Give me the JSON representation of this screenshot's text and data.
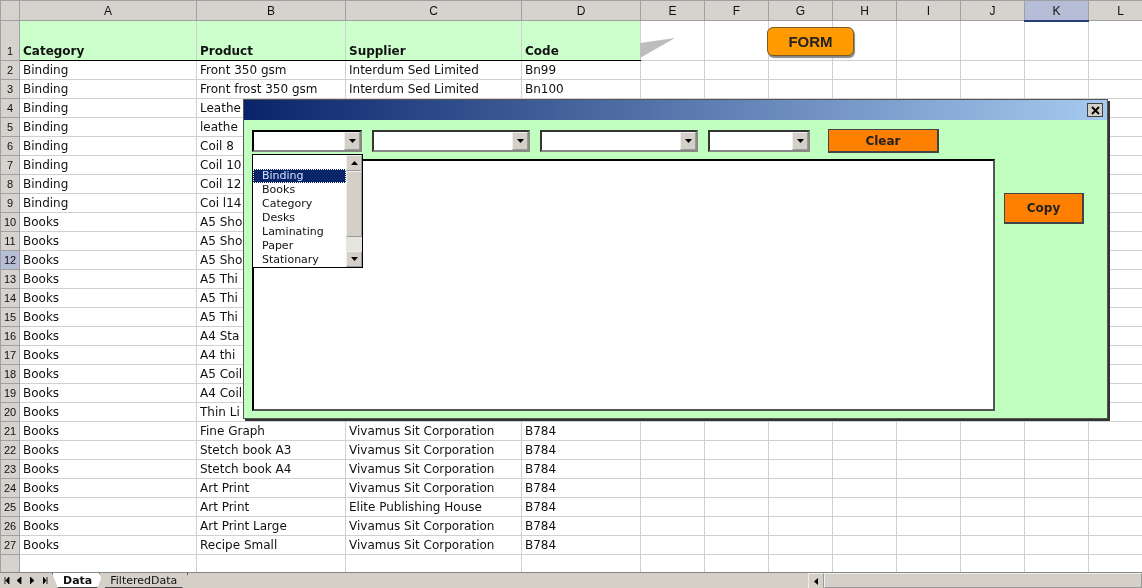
{
  "columns": [
    {
      "label": "A",
      "selected": false
    },
    {
      "label": "B",
      "selected": false
    },
    {
      "label": "C",
      "selected": false
    },
    {
      "label": "D",
      "selected": false
    },
    {
      "label": "E",
      "selected": false
    },
    {
      "label": "F",
      "selected": false
    },
    {
      "label": "G",
      "selected": false
    },
    {
      "label": "H",
      "selected": false
    },
    {
      "label": "I",
      "selected": false
    },
    {
      "label": "J",
      "selected": false
    },
    {
      "label": "K",
      "selected": true
    },
    {
      "label": "L",
      "selected": false
    }
  ],
  "rows": [
    {
      "number": "1",
      "selected": false,
      "kind": "header",
      "cells": [
        "Category",
        "Product",
        "Supplier",
        "Code"
      ]
    },
    {
      "number": "2",
      "selected": false,
      "kind": "data",
      "cells": [
        "Binding",
        "Front 350 gsm",
        "Interdum Sed Limited",
        "Bn99"
      ]
    },
    {
      "number": "3",
      "selected": false,
      "kind": "data",
      "cells": [
        "Binding",
        "Front frost 350 gsm",
        "Interdum Sed Limited",
        "Bn100"
      ]
    },
    {
      "number": "4",
      "selected": false,
      "kind": "data",
      "cells": [
        "Binding",
        "Leathe"
      ]
    },
    {
      "number": "5",
      "selected": false,
      "kind": "data",
      "cells": [
        "Binding",
        "leathe"
      ]
    },
    {
      "number": "6",
      "selected": false,
      "kind": "data",
      "cells": [
        "Binding",
        "Coil 8"
      ]
    },
    {
      "number": "7",
      "selected": false,
      "kind": "data",
      "cells": [
        "Binding",
        "Coil 10"
      ]
    },
    {
      "number": "8",
      "selected": false,
      "kind": "data",
      "cells": [
        "Binding",
        "Coil 12"
      ]
    },
    {
      "number": "9",
      "selected": false,
      "kind": "data",
      "cells": [
        "Binding",
        "Coi l14"
      ]
    },
    {
      "number": "10",
      "selected": false,
      "kind": "data",
      "cells": [
        "Books",
        "A5 Sho"
      ]
    },
    {
      "number": "11",
      "selected": false,
      "kind": "data",
      "cells": [
        "Books",
        "A5 Sho"
      ]
    },
    {
      "number": "12",
      "selected": true,
      "kind": "data",
      "cells": [
        "Books",
        "A5 Sho"
      ]
    },
    {
      "number": "13",
      "selected": false,
      "kind": "data",
      "cells": [
        "Books",
        "A5 Thi"
      ]
    },
    {
      "number": "14",
      "selected": false,
      "kind": "data",
      "cells": [
        "Books",
        "A5 Thi"
      ]
    },
    {
      "number": "15",
      "selected": false,
      "kind": "data",
      "cells": [
        "Books",
        "A5 Thi"
      ]
    },
    {
      "number": "16",
      "selected": false,
      "kind": "data",
      "cells": [
        "Books",
        "A4 Sta"
      ]
    },
    {
      "number": "17",
      "selected": false,
      "kind": "data",
      "cells": [
        "Books",
        "A4 thi"
      ]
    },
    {
      "number": "18",
      "selected": false,
      "kind": "data",
      "cells": [
        "Books",
        "A5 Coil"
      ]
    },
    {
      "number": "19",
      "selected": false,
      "kind": "data",
      "cells": [
        "Books",
        "A4 Coil"
      ]
    },
    {
      "number": "20",
      "selected": false,
      "kind": "data",
      "cells": [
        "Books",
        "Thin Li"
      ]
    },
    {
      "number": "21",
      "selected": false,
      "kind": "data",
      "cells": [
        "Books",
        "Fine Graph",
        "Vivamus Sit Corporation",
        "B784"
      ]
    },
    {
      "number": "22",
      "selected": false,
      "kind": "data",
      "cells": [
        "Books",
        "Stetch book A3",
        "Vivamus Sit Corporation",
        "B784"
      ]
    },
    {
      "number": "23",
      "selected": false,
      "kind": "data",
      "cells": [
        "Books",
        "Stetch book A4",
        "Vivamus Sit Corporation",
        "B784"
      ]
    },
    {
      "number": "24",
      "selected": false,
      "kind": "data",
      "cells": [
        "Books",
        "Art Print",
        "Vivamus Sit Corporation",
        "B784"
      ]
    },
    {
      "number": "25",
      "selected": false,
      "kind": "data",
      "cells": [
        "Books",
        "Art Print",
        "Elite Publishing House",
        "B784"
      ]
    },
    {
      "number": "26",
      "selected": false,
      "kind": "data",
      "cells": [
        "Books",
        "Art Print  Large",
        "Vivamus Sit Corporation",
        "B784"
      ]
    },
    {
      "number": "27",
      "selected": false,
      "kind": "data",
      "cells": [
        "Books",
        "Recipe Small",
        "Vivamus Sit Corporation",
        "B784"
      ]
    }
  ],
  "form_button": "FORM",
  "dialog": {
    "combos": [
      {
        "expanded": true,
        "options": [
          {
            "label": "Binding",
            "selected": true
          },
          {
            "label": "Books",
            "selected": false
          },
          {
            "label": "Category",
            "selected": false
          },
          {
            "label": "Desks",
            "selected": false
          },
          {
            "label": "Laminating",
            "selected": false
          },
          {
            "label": "Paper",
            "selected": false
          },
          {
            "label": "Stationary",
            "selected": false
          }
        ]
      },
      {
        "expanded": false
      },
      {
        "expanded": false
      },
      {
        "expanded": false
      }
    ],
    "clear_button": "Clear",
    "copy_button": "Copy"
  },
  "sheet_tabs": [
    {
      "label": "Data",
      "selected": true
    },
    {
      "label": "FilteredData",
      "selected": false
    }
  ]
}
